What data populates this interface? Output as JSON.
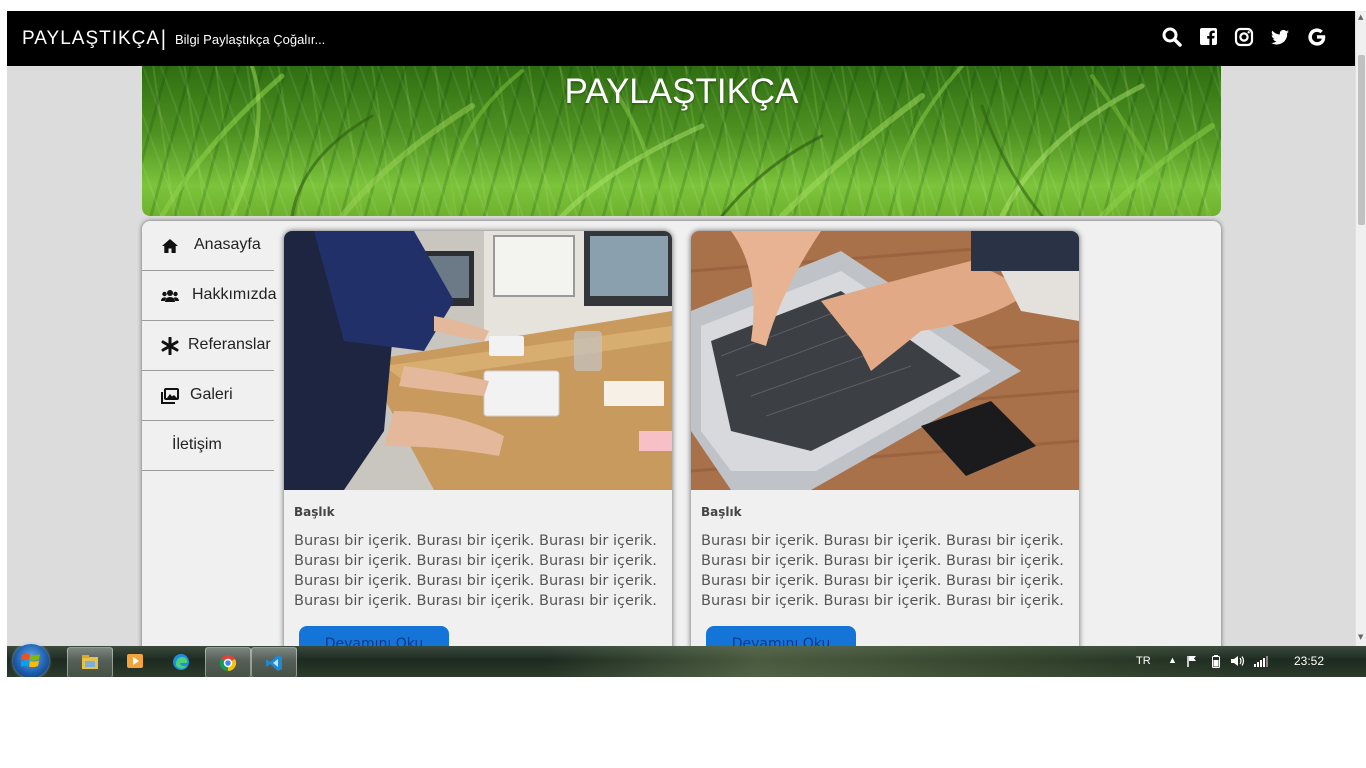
{
  "header": {
    "brand": "PAYLAŞTIKÇA",
    "separator": "|",
    "tagline": "Bilgi Paylaştıkça Çoğalır...",
    "social_icons": [
      "search-icon",
      "facebook-icon",
      "instagram-icon",
      "twitter-icon",
      "google-icon"
    ]
  },
  "hero": {
    "title": "PAYLAŞTIKÇA"
  },
  "sidebar": {
    "items": [
      {
        "label": "Anasayfa",
        "icon": "home-icon"
      },
      {
        "label": "Hakkımızda",
        "icon": "users-icon"
      },
      {
        "label": "Referanslar",
        "icon": "asterisk-icon"
      },
      {
        "label": "Galeri",
        "icon": "images-icon"
      },
      {
        "label": "İletişim",
        "icon": ""
      }
    ]
  },
  "cards": [
    {
      "image": "office-desk-typing-photo",
      "title": "Başlık",
      "body": "Burası bir içerik. Burası bir içerik. Burası bir içerik. Burası bir içerik. Burası bir içerik. Burası bir içerik. Burası bir içerik. Burası bir içerik. Burası bir içerik. Burası bir içerik. Burası bir içerik. Burası bir içerik.",
      "button": "Devamını Oku"
    },
    {
      "image": "hands-on-laptop-photo",
      "title": "Başlık",
      "body": "Burası bir içerik. Burası bir içerik. Burası bir içerik. Burası bir içerik. Burası bir içerik. Burası bir içerik. Burası bir içerik. Burası bir içerik. Burası bir içerik. Burası bir içerik. Burası bir içerik. Burası bir içerik.",
      "button": "Devamını Oku"
    }
  ],
  "taskbar": {
    "apps": [
      "file-explorer-icon",
      "media-player-icon",
      "edge-icon",
      "chrome-icon",
      "vscode-icon"
    ],
    "language": "TR",
    "clock": "23:52"
  },
  "colors": {
    "topbar": "#000000",
    "page_background": "#dcdcdc",
    "panel": "#f0f0f0",
    "button": "#1574d8"
  }
}
